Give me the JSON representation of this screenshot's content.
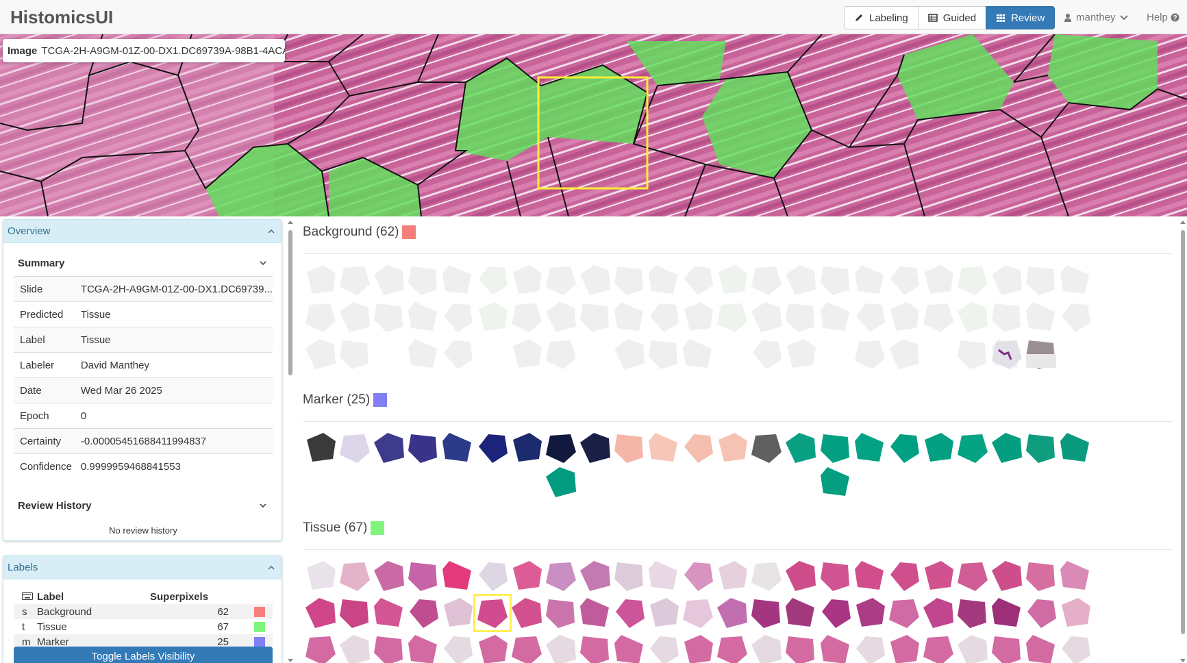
{
  "app": {
    "title": "HistomicsUI"
  },
  "nav": {
    "modes": [
      {
        "label": "Labeling",
        "icon": "pencil-icon"
      },
      {
        "label": "Guided",
        "icon": "table-icon"
      },
      {
        "label": "Review",
        "icon": "grid-icon",
        "active": true
      }
    ],
    "user": "manthey",
    "help": "Help"
  },
  "viewer": {
    "image_label": "Image",
    "image_name": "TCGA-2H-A9GM-01Z-00-DX1.DC69739A-98B1-4ACA-9..."
  },
  "overview": {
    "title": "Overview",
    "summary_title": "Summary",
    "rows": [
      {
        "key": "Slide",
        "value": "TCGA-2H-A9GM-01Z-00-DX1.DC69739..."
      },
      {
        "key": "Predicted",
        "value": "Tissue"
      },
      {
        "key": "Label",
        "value": "Tissue"
      },
      {
        "key": "Labeler",
        "value": "David Manthey"
      },
      {
        "key": "Date",
        "value": "Wed Mar 26 2025"
      },
      {
        "key": "Epoch",
        "value": "0"
      },
      {
        "key": "Certainty",
        "value": "-0.00005451688411994837"
      },
      {
        "key": "Confidence",
        "value": "0.9999959468841553"
      }
    ],
    "review_history_title": "Review History",
    "no_history": "No review history"
  },
  "labels_panel": {
    "title": "Labels",
    "col_label": "Label",
    "col_superpixels": "Superpixels",
    "rows": [
      {
        "key": "s",
        "name": "Background",
        "count": "62",
        "color": "#f77f7b"
      },
      {
        "key": "t",
        "name": "Tissue",
        "count": "67",
        "color": "#80f57c"
      },
      {
        "key": "m",
        "name": "Marker",
        "count": "25",
        "color": "#807ff5"
      }
    ],
    "toggle_button": "Toggle Labels Visibility"
  },
  "review": {
    "categories": [
      {
        "title": "Background (62)",
        "color": "#f77f7b"
      },
      {
        "title": "Marker (25)",
        "color": "#807ff5"
      },
      {
        "title": "Tissue (67)",
        "color": "#80f57c"
      }
    ]
  },
  "colors": {
    "accent": "#337ab7",
    "panel_head": "#d9edf7",
    "highlight": "#ffee55"
  }
}
